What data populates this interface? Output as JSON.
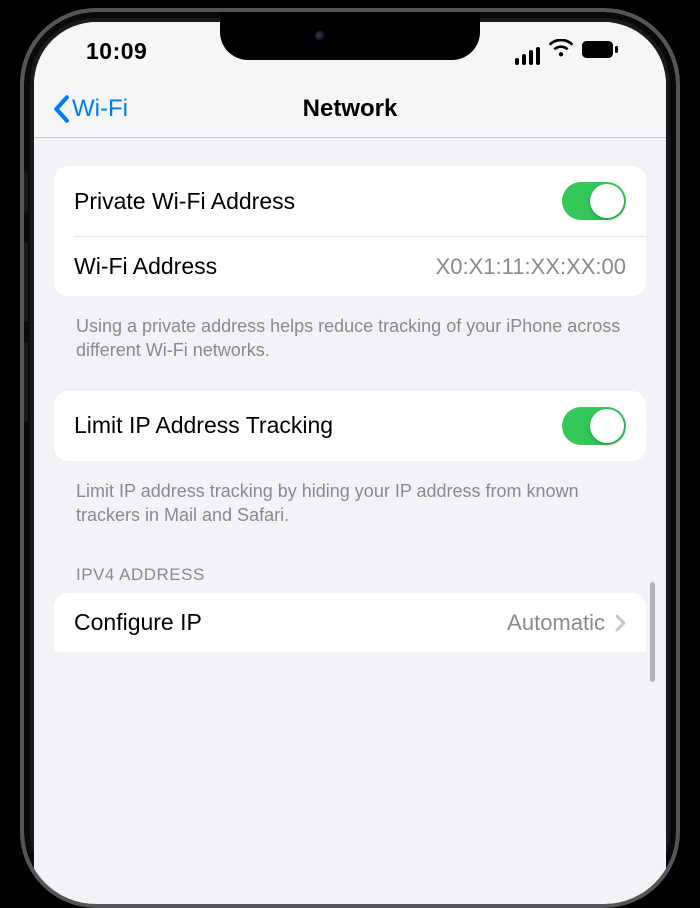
{
  "statusBar": {
    "time": "10:09"
  },
  "nav": {
    "back": "Wi-Fi",
    "title": "Network"
  },
  "privateWifi": {
    "toggleLabel": "Private Wi-Fi Address",
    "toggleOn": true,
    "addressLabel": "Wi-Fi Address",
    "addressValue": "X0:X1:11:XX:XX:00",
    "footer": "Using a private address helps reduce tracking of your iPhone across different Wi-Fi networks."
  },
  "limitTracking": {
    "label": "Limit IP Address Tracking",
    "on": true,
    "footer": "Limit IP address tracking by hiding your IP address from known trackers in Mail and Safari."
  },
  "ipv4": {
    "header": "IPV4 ADDRESS",
    "configureLabel": "Configure IP",
    "configureValue": "Automatic"
  }
}
